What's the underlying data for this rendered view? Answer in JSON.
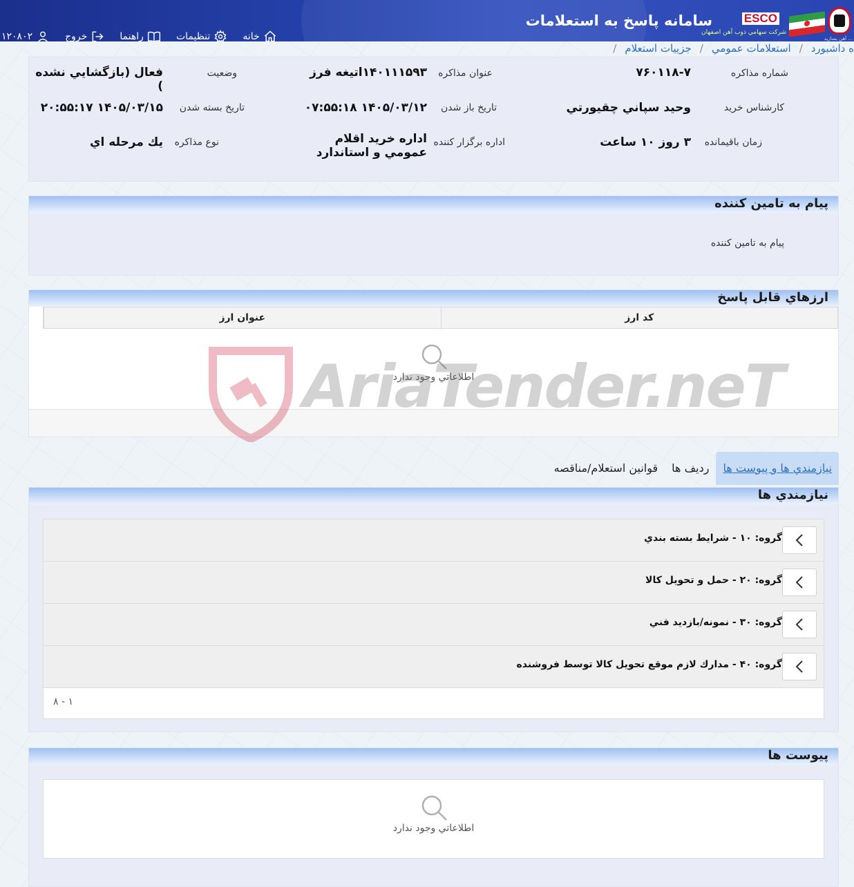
{
  "header": {
    "title": "سامانه پاسخ به استعلامات",
    "esco_logo": "ESCO",
    "company_name": "شركت سهامي ذوب آهن اصفهان",
    "brand_tiny": "آهن بسازيد ...",
    "nav": {
      "home": "خانه",
      "settings": "تنظيمات",
      "help": "راهنما",
      "logout": "خروج",
      "user_id": "۱۲۰۸۰۲"
    },
    "colors": {
      "bar": "#2440a8",
      "accent": "#c8102e"
    }
  },
  "breadcrumb": {
    "dashboard": "ه داشبورد",
    "public_inquiries": "استعلامات عمومي",
    "current": "جزييات استعلام"
  },
  "info": {
    "number_label": "شماره مذاكره",
    "number_value": "۷۶۰۱۱۸-۷",
    "title_label": "عنوان مذاكره",
    "title_value": "۱۴۰۱۱۱۵۹۳اتيغه فرز",
    "status_label": "وضعيت",
    "status_value": "فعال (بازگشايي نشده )",
    "expert_label": "كارشناس خريد",
    "expert_value": "وحيد سپاني چقيورتي",
    "open_label": "تاريخ باز شدن",
    "open_value": "۱۴۰۵/۰۳/۱۲ ۰۷:۵۵:۱۸",
    "close_label": "تاريخ بسته شدن",
    "close_value": "۱۴۰۵/۰۳/۱۵ ۲۰:۵۵:۱۷",
    "remaining_label": "زمان باقيمانده",
    "remaining_value": "۳ روز ۱۰ ساعت",
    "office_label": "اداره برگزار كننده",
    "office_value": "اداره خريد اقلام عمومي و استاندارد",
    "type_label": "نوع مذاكره",
    "type_value": "يك مرحله اي"
  },
  "message": {
    "title": "پيام به تامين كننده",
    "label": "پيام به تامين كننده"
  },
  "currencies": {
    "title": "ارزهاي قابل پاسخ",
    "columns": [
      "كد ارز",
      "عنوان ارز"
    ],
    "empty_text": "اطلاعاتي وجود ندارد"
  },
  "tabs": [
    "نيازمندي ها و پيوست ها",
    "رديف ها",
    "قوانين استعلام/مناقصه"
  ],
  "needs": {
    "title": "نيازمندي ها",
    "groups": [
      "گروه: ۱۰ - شرايط بسته بندي",
      "گروه: ۲۰ - حمل و تحويل كالا",
      "گروه: ۳۰ - نمونه/بازديد فني",
      "گروه: ۴۰ - مدارك لازم موقع تحويل كالا توسط فروشنده"
    ],
    "pager": "۱ - ۸"
  },
  "attachments": {
    "title": "پيوست ها",
    "empty_text": "اطلاعاتي وجود ندارد"
  },
  "watermark": {
    "text": "AriaTender.neT",
    "color": "#c8102e"
  }
}
